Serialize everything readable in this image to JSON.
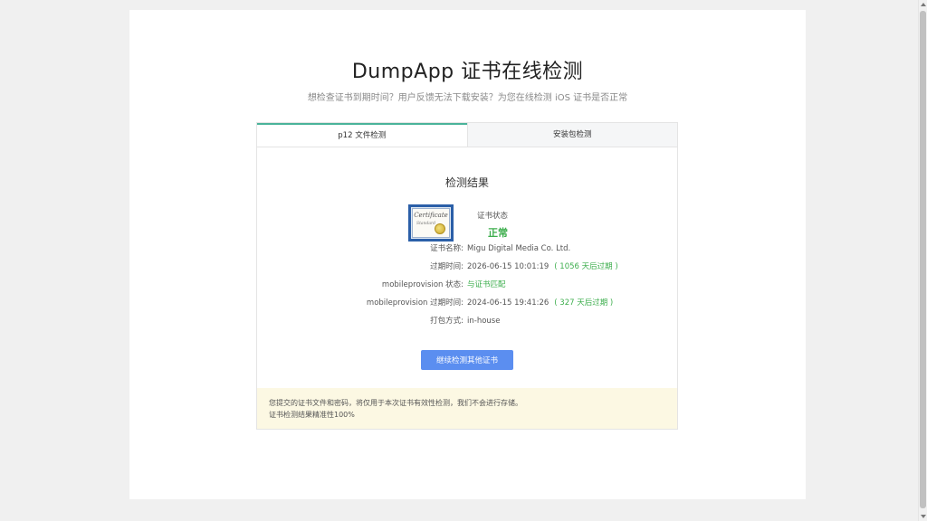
{
  "header": {
    "title": "DumpApp 证书在线检测",
    "subtitle": "想检查证书到期时间？用户反馈无法下载安装？为您在线检测 iOS 证书是否正常"
  },
  "tabs": [
    {
      "label": "p12 文件检测",
      "active": true
    },
    {
      "label": "安装包检测",
      "active": false
    }
  ],
  "result": {
    "title": "检测结果",
    "status_label": "证书状态",
    "status_value": "正常",
    "certificate_icon": {
      "title": "Certificate",
      "subtitle": "Standard"
    },
    "rows": [
      {
        "key": "证书名称:",
        "value": "Migu Digital Media Co. Ltd.",
        "extra": ""
      },
      {
        "key": "过期时间:",
        "value": "2026-06-15 10:01:19",
        "extra": "( 1056 天后过期 )"
      },
      {
        "key": "mobileprovision 状态:",
        "value": "与证书匹配",
        "extra": ""
      },
      {
        "key": "mobileprovision 过期时间:",
        "value": "2024-06-15 19:41:26",
        "extra": "( 327 天后过期 )"
      },
      {
        "key": "打包方式:",
        "value": "in-house",
        "extra": ""
      }
    ],
    "button_label": "继续检测其他证书"
  },
  "notice": {
    "line1": "您提交的证书文件和密码，将仅用于本次证书有效性检测，我们不会进行存储。",
    "line2": "证书检测结果精准性100%"
  },
  "colors": {
    "accent_tab": "#4ab39a",
    "status_green": "#3dae4d",
    "button_blue": "#5b8ef0",
    "notice_bg": "#fcf8e3"
  }
}
